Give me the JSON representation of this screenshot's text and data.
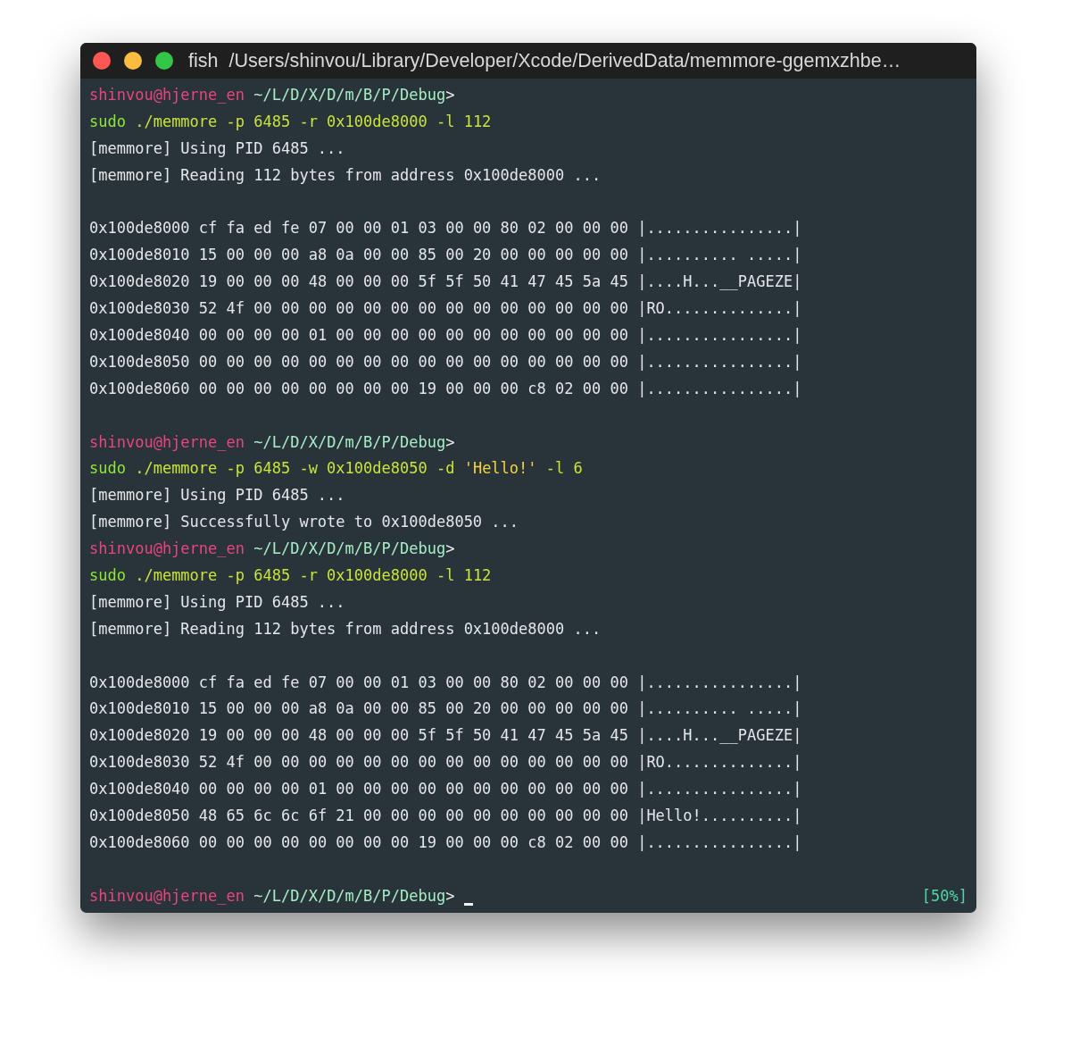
{
  "window": {
    "title": "fish  /Users/shinvou/Library/Developer/Xcode/DerivedData/memmore-ggemxzhbe…",
    "controls": [
      {
        "kind": "close"
      },
      {
        "kind": "minimize"
      },
      {
        "kind": "zoom"
      }
    ]
  },
  "lines": [
    {
      "kind": "prompt",
      "user": "shinvou@hjerne_en",
      "path": "~/L/D/X/D/m/B/P/Debug",
      "symbol": ">"
    },
    {
      "kind": "command",
      "parts": [
        {
          "kind": "program",
          "text": "sudo"
        },
        {
          "kind": "arg",
          "text": " ./memmore -p 6485 -r 0x100de8000 -l 112"
        }
      ]
    },
    {
      "kind": "output",
      "text": "[memmore] Using PID 6485 ..."
    },
    {
      "kind": "output",
      "text": "[memmore] Reading 112 bytes from address 0x100de8000 ..."
    },
    {
      "kind": "blank"
    },
    {
      "kind": "hex",
      "address": "0x100de8000",
      "bytes": "cf fa ed fe 07 00 00 01 03 00 00 80 02 00 00 00",
      "ascii": "|................|"
    },
    {
      "kind": "hex",
      "address": "0x100de8010",
      "bytes": "15 00 00 00 a8 0a 00 00 85 00 20 00 00 00 00 00",
      "ascii": "|.......... .....|"
    },
    {
      "kind": "hex",
      "address": "0x100de8020",
      "bytes": "19 00 00 00 48 00 00 00 5f 5f 50 41 47 45 5a 45",
      "ascii": "|....H...__PAGEZE|"
    },
    {
      "kind": "hex",
      "address": "0x100de8030",
      "bytes": "52 4f 00 00 00 00 00 00 00 00 00 00 00 00 00 00",
      "ascii": "|RO..............|"
    },
    {
      "kind": "hex",
      "address": "0x100de8040",
      "bytes": "00 00 00 00 01 00 00 00 00 00 00 00 00 00 00 00",
      "ascii": "|................|"
    },
    {
      "kind": "hex",
      "address": "0x100de8050",
      "bytes": "00 00 00 00 00 00 00 00 00 00 00 00 00 00 00 00",
      "ascii": "|................|"
    },
    {
      "kind": "hex",
      "address": "0x100de8060",
      "bytes": "00 00 00 00 00 00 00 00 19 00 00 00 c8 02 00 00",
      "ascii": "|................|"
    },
    {
      "kind": "blank"
    },
    {
      "kind": "prompt",
      "user": "shinvou@hjerne_en",
      "path": "~/L/D/X/D/m/B/P/Debug",
      "symbol": ">"
    },
    {
      "kind": "command",
      "parts": [
        {
          "kind": "program",
          "text": "sudo"
        },
        {
          "kind": "arg",
          "text": " ./memmore -p 6485 -w 0x100de8050 -d "
        },
        {
          "kind": "string",
          "text": "'Hello!'"
        },
        {
          "kind": "arg",
          "text": " -l 6"
        }
      ]
    },
    {
      "kind": "output",
      "text": "[memmore] Using PID 6485 ..."
    },
    {
      "kind": "output",
      "text": "[memmore] Successfully wrote to 0x100de8050 ..."
    },
    {
      "kind": "prompt",
      "user": "shinvou@hjerne_en",
      "path": "~/L/D/X/D/m/B/P/Debug",
      "symbol": ">"
    },
    {
      "kind": "command",
      "parts": [
        {
          "kind": "program",
          "text": "sudo"
        },
        {
          "kind": "arg",
          "text": " ./memmore -p 6485 -r 0x100de8000 -l 112"
        }
      ]
    },
    {
      "kind": "output",
      "text": "[memmore] Using PID 6485 ..."
    },
    {
      "kind": "output",
      "text": "[memmore] Reading 112 bytes from address 0x100de8000 ..."
    },
    {
      "kind": "blank"
    },
    {
      "kind": "hex",
      "address": "0x100de8000",
      "bytes": "cf fa ed fe 07 00 00 01 03 00 00 80 02 00 00 00",
      "ascii": "|................|"
    },
    {
      "kind": "hex",
      "address": "0x100de8010",
      "bytes": "15 00 00 00 a8 0a 00 00 85 00 20 00 00 00 00 00",
      "ascii": "|.......... .....|"
    },
    {
      "kind": "hex",
      "address": "0x100de8020",
      "bytes": "19 00 00 00 48 00 00 00 5f 5f 50 41 47 45 5a 45",
      "ascii": "|....H...__PAGEZE|"
    },
    {
      "kind": "hex",
      "address": "0x100de8030",
      "bytes": "52 4f 00 00 00 00 00 00 00 00 00 00 00 00 00 00",
      "ascii": "|RO..............|"
    },
    {
      "kind": "hex",
      "address": "0x100de8040",
      "bytes": "00 00 00 00 01 00 00 00 00 00 00 00 00 00 00 00",
      "ascii": "|................|"
    },
    {
      "kind": "hex",
      "address": "0x100de8050",
      "bytes": "48 65 6c 6c 6f 21 00 00 00 00 00 00 00 00 00 00",
      "ascii": "|Hello!..........|"
    },
    {
      "kind": "hex",
      "address": "0x100de8060",
      "bytes": "00 00 00 00 00 00 00 00 19 00 00 00 c8 02 00 00",
      "ascii": "|................|"
    },
    {
      "kind": "blank"
    },
    {
      "kind": "prompt",
      "user": "shinvou@hjerne_en",
      "path": "~/L/D/X/D/m/B/P/Debug",
      "symbol": ">",
      "cursor": true,
      "status": "[50%]"
    }
  ]
}
